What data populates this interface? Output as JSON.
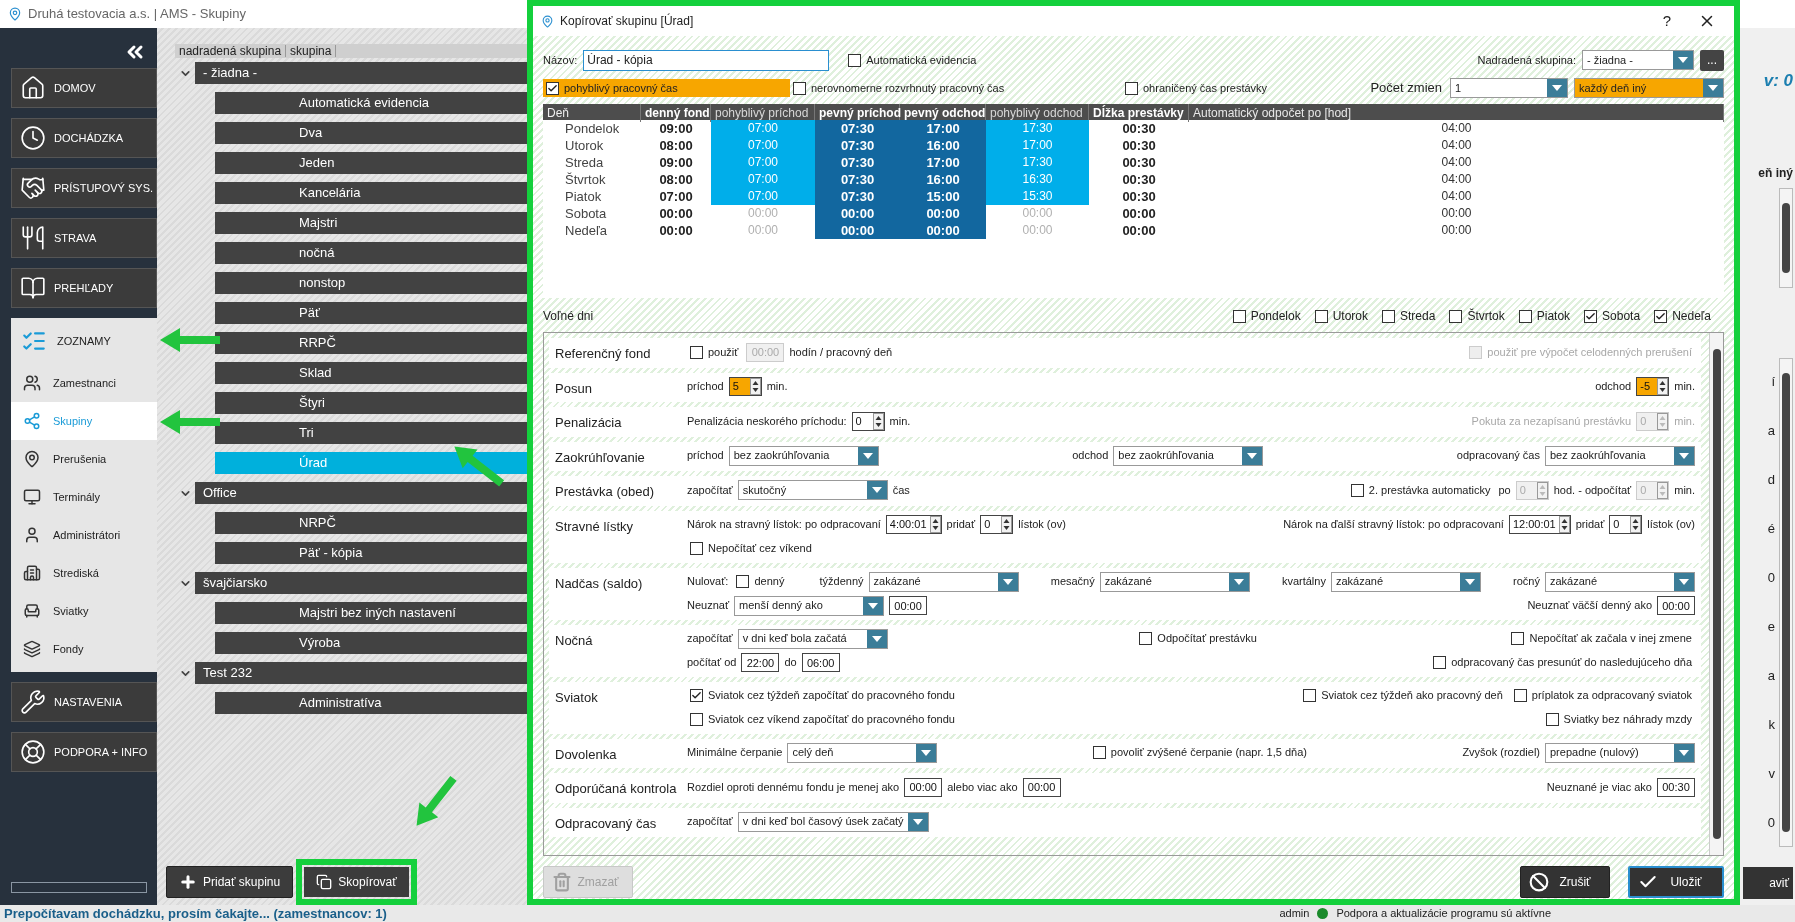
{
  "window": {
    "title": "Druhá testovacia a.s. | AMS - Skupiny"
  },
  "nav": [
    {
      "label": "DOMOV",
      "expanded": false
    },
    {
      "label": "DOCHÁDZKA",
      "expanded": false
    },
    {
      "label": "PRÍSTUPOVÝ SYS.",
      "expanded": false
    },
    {
      "label": "STRAVA",
      "expanded": false
    },
    {
      "label": "PREHĽADY",
      "expanded": false
    },
    {
      "label": "ZOZNAMY",
      "expanded": true,
      "children": [
        {
          "label": "Zamestnanci",
          "selected": false
        },
        {
          "label": "Skupiny",
          "selected": true
        },
        {
          "label": "Prerušenia",
          "selected": false
        },
        {
          "label": "Terminály",
          "selected": false
        },
        {
          "label": "Administrátori",
          "selected": false
        },
        {
          "label": "Strediská",
          "selected": false
        },
        {
          "label": "Sviatky",
          "selected": false
        },
        {
          "label": "Fondy",
          "selected": false
        }
      ]
    },
    {
      "label": "NASTAVENIA",
      "expanded": false
    },
    {
      "label": "PODPORA + INFO",
      "expanded": false
    }
  ],
  "tree": {
    "columns": [
      "nadradená skupina",
      "skupina"
    ],
    "groups": [
      {
        "label": "- žiadna -",
        "expanded": true,
        "children": [
          {
            "label": "Automatická evidencia",
            "selected": false
          },
          {
            "label": "Dva",
            "selected": false
          },
          {
            "label": "Jeden",
            "selected": false
          },
          {
            "label": "Kancelária",
            "selected": false
          },
          {
            "label": "Majstri",
            "selected": false
          },
          {
            "label": "nočná",
            "selected": false
          },
          {
            "label": "nonstop",
            "selected": false
          },
          {
            "label": "Päť",
            "selected": false
          },
          {
            "label": "RRPČ",
            "selected": false
          },
          {
            "label": "Sklad",
            "selected": false
          },
          {
            "label": "Štyri",
            "selected": false
          },
          {
            "label": "Tri",
            "selected": false
          },
          {
            "label": "Úrad",
            "selected": true
          }
        ]
      },
      {
        "label": "Office",
        "expanded": true,
        "children": [
          {
            "label": "NRPČ",
            "selected": false
          },
          {
            "label": "Päť - kópia",
            "selected": false
          }
        ]
      },
      {
        "label": "švajčiarsko",
        "expanded": true,
        "children": [
          {
            "label": "Majstri bez iných nastavení",
            "selected": false
          },
          {
            "label": "Výroba",
            "selected": false
          }
        ]
      },
      {
        "label": "Test 232",
        "expanded": true,
        "children": [
          {
            "label": "Administratíva",
            "selected": false
          }
        ]
      }
    ]
  },
  "tree_buttons": [
    "Pridať skupinu",
    "Skopírovať"
  ],
  "background_panel": {
    "count": "v: 0",
    "mode": "eň iný",
    "fragments": [
      "í",
      "a",
      "d",
      "é",
      "0",
      "e",
      "a",
      "k",
      "v",
      "0"
    ],
    "button": "aviť"
  },
  "status_bar": {
    "message": "Prepočítavam dochádzku, prosím čakajte... (zamestnancov: 1)",
    "user": "admin",
    "support": "Podpora a aktualizácie programu sú aktívne"
  },
  "dialog": {
    "title": "Kopírovať skupinu [Úrad]",
    "help": "?",
    "name": {
      "label": "Názov:",
      "value": "Úrad - kópia"
    },
    "auto_evidence": {
      "label": "Automatická evidencia",
      "checked": false
    },
    "parent": {
      "label": "Nadradená skupina:",
      "value": "- žiadna -",
      "more": "..."
    },
    "options": [
      {
        "label": "pohyblivý pracovný čas",
        "checked": true
      },
      {
        "label": "nerovnomerne rozvrhnutý pracovný čas",
        "checked": false
      },
      {
        "label": "ohraničený čas prestávky",
        "checked": false
      }
    ],
    "shifts": {
      "label": "Počet zmien",
      "count": {
        "value": "1",
        "highlighted": false
      },
      "mode": {
        "value": "každý deň iný",
        "highlighted": true
      }
    },
    "schedule": {
      "columns": [
        "Deň",
        "denný fond",
        "pohyblivý príchod",
        "pevný príchod",
        "pevný odchod",
        "pohyblivý odchod",
        "Dĺžka prestávky",
        "Automatický odpočet po [hod]"
      ],
      "rows": [
        {
          "cells": [
            "Pondelok",
            "09:00",
            "07:00",
            "07:30",
            "17:00",
            "17:30",
            "00:30",
            "04:00"
          ],
          "flexible": true
        },
        {
          "cells": [
            "Utorok",
            "08:00",
            "07:00",
            "07:30",
            "16:00",
            "17:00",
            "00:30",
            "04:00"
          ],
          "flexible": true
        },
        {
          "cells": [
            "Streda",
            "09:00",
            "07:00",
            "07:30",
            "17:00",
            "17:30",
            "00:30",
            "04:00"
          ],
          "flexible": true
        },
        {
          "cells": [
            "Štvrtok",
            "08:00",
            "07:00",
            "07:30",
            "16:00",
            "16:30",
            "00:30",
            "04:00"
          ],
          "flexible": true
        },
        {
          "cells": [
            "Piatok",
            "07:00",
            "07:00",
            "07:30",
            "15:00",
            "15:30",
            "00:30",
            "04:00"
          ],
          "flexible": true
        },
        {
          "cells": [
            "Sobota",
            "00:00",
            "00:00",
            "00:00",
            "00:00",
            "00:00",
            "00:00",
            "00:00"
          ],
          "flexible": false
        },
        {
          "cells": [
            "Nedeľa",
            "00:00",
            "00:00",
            "00:00",
            "00:00",
            "00:00",
            "00:00",
            "00:00"
          ],
          "flexible": false
        }
      ]
    },
    "free_days": {
      "label": "Voľné dni",
      "days": [
        {
          "label": "Pondelok",
          "checked": false
        },
        {
          "label": "Utorok",
          "checked": false
        },
        {
          "label": "Streda",
          "checked": false
        },
        {
          "label": "Štvrtok",
          "checked": false
        },
        {
          "label": "Piatok",
          "checked": false
        },
        {
          "label": "Sobota",
          "checked": true
        },
        {
          "label": "Nedeľa",
          "checked": true
        }
      ]
    },
    "settings": [
      {
        "title": "Referenčný fond",
        "lines": [
          {
            "groups": [
              [
                {
                  "kind": "checkbox",
                  "label": "použiť",
                  "checked": false,
                  "disabled": false
                },
                {
                  "kind": "input",
                  "value": "00:00",
                  "disabled": true
                },
                {
                  "kind": "text",
                  "text": "hodín / pracovný deň",
                  "disabled": false
                }
              ],
              [
                {
                  "kind": "checkbox",
                  "label": "použiť pre výpočet celodenných prerušení",
                  "checked": false,
                  "disabled": true
                }
              ]
            ]
          }
        ]
      },
      {
        "title": "Posun",
        "lines": [
          {
            "groups": [
              [
                {
                  "kind": "text",
                  "text": "príchod",
                  "disabled": false
                },
                {
                  "kind": "spin",
                  "value": "5",
                  "highlighted": true,
                  "disabled": false
                },
                {
                  "kind": "text",
                  "text": "min.",
                  "disabled": false
                }
              ],
              [
                {
                  "kind": "text",
                  "text": "odchod",
                  "disabled": false
                },
                {
                  "kind": "spin",
                  "value": "-5",
                  "highlighted": true,
                  "disabled": false
                },
                {
                  "kind": "text",
                  "text": "min.",
                  "disabled": false
                }
              ]
            ]
          }
        ]
      },
      {
        "title": "Penalizácia",
        "lines": [
          {
            "groups": [
              [
                {
                  "kind": "text",
                  "text": "Penalizácia neskorého príchodu:",
                  "disabled": false
                },
                {
                  "kind": "spin",
                  "value": "0",
                  "highlighted": false,
                  "disabled": false
                },
                {
                  "kind": "text",
                  "text": "min.",
                  "disabled": false
                }
              ],
              [
                {
                  "kind": "text",
                  "text": "Pokuta za nezapísanú prestávku",
                  "disabled": true
                },
                {
                  "kind": "spin",
                  "value": "0",
                  "highlighted": false,
                  "disabled": true
                },
                {
                  "kind": "text",
                  "text": "min.",
                  "disabled": true
                }
              ]
            ]
          }
        ]
      },
      {
        "title": "Zaokrúhľovanie",
        "lines": [
          {
            "groups": [
              [
                {
                  "kind": "text",
                  "text": "príchod",
                  "disabled": false
                },
                {
                  "kind": "select",
                  "value": "bez zaokrúhľovania",
                  "disabled": false
                }
              ],
              [
                {
                  "kind": "text",
                  "text": "odchod",
                  "disabled": false
                },
                {
                  "kind": "select",
                  "value": "bez zaokrúhľovania",
                  "disabled": false
                }
              ],
              [
                {
                  "kind": "text",
                  "text": "odpracovaný čas",
                  "disabled": false
                },
                {
                  "kind": "select",
                  "value": "bez zaokrúhľovania",
                  "disabled": false
                }
              ]
            ]
          }
        ]
      },
      {
        "title": "Prestávka (obed)",
        "lines": [
          {
            "groups": [
              [
                {
                  "kind": "text",
                  "text": "započítať",
                  "disabled": false
                },
                {
                  "kind": "select",
                  "value": "skutočný",
                  "disabled": false
                },
                {
                  "kind": "text",
                  "text": "čas",
                  "disabled": false
                }
              ],
              [
                {
                  "kind": "checkbox",
                  "label": "2. prestávka automaticky",
                  "checked": false,
                  "disabled": false
                },
                {
                  "kind": "text",
                  "text": "po",
                  "disabled": false
                },
                {
                  "kind": "spin",
                  "value": "0",
                  "highlighted": false,
                  "disabled": true
                },
                {
                  "kind": "text",
                  "text": "hod. - odpočítať",
                  "disabled": false
                },
                {
                  "kind": "spin",
                  "value": "0",
                  "highlighted": false,
                  "disabled": true
                },
                {
                  "kind": "text",
                  "text": "min.",
                  "disabled": false
                }
              ]
            ]
          }
        ]
      },
      {
        "title": "Stravné lístky",
        "lines": [
          {
            "groups": [
              [
                {
                  "kind": "text",
                  "text": "Nárok na stravný lístok: po odpracovaní",
                  "disabled": false
                },
                {
                  "kind": "spin",
                  "value": "4:00:01",
                  "highlighted": false,
                  "disabled": false
                },
                {
                  "kind": "text",
                  "text": "pridať",
                  "disabled": false
                },
                {
                  "kind": "spin",
                  "value": "0",
                  "highlighted": false,
                  "disabled": false
                },
                {
                  "kind": "text",
                  "text": "lístok (ov)",
                  "disabled": false
                }
              ],
              [
                {
                  "kind": "text",
                  "text": "Nárok na ďalší stravný lístok: po odpracovaní",
                  "disabled": false
                },
                {
                  "kind": "spin",
                  "value": "12:00:01",
                  "highlighted": false,
                  "disabled": false
                },
                {
                  "kind": "text",
                  "text": "pridať",
                  "disabled": false
                },
                {
                  "kind": "spin",
                  "value": "0",
                  "highlighted": false,
                  "disabled": false
                },
                {
                  "kind": "text",
                  "text": "lístok (ov)",
                  "disabled": false
                }
              ]
            ]
          },
          {
            "groups": [
              [
                {
                  "kind": "checkbox",
                  "label": "Nepočítať cez víkend",
                  "checked": false,
                  "disabled": false
                }
              ]
            ]
          }
        ]
      },
      {
        "title": "Nadčas (saldo)",
        "lines": [
          {
            "groups": [
              [
                {
                  "kind": "text",
                  "text": "Nulovať:",
                  "disabled": false
                },
                {
                  "kind": "checkbox",
                  "label": "denný",
                  "checked": false,
                  "disabled": false
                }
              ],
              [
                {
                  "kind": "text",
                  "text": "týždenný",
                  "disabled": false
                },
                {
                  "kind": "select",
                  "value": "zakázané",
                  "disabled": false
                }
              ],
              [
                {
                  "kind": "text",
                  "text": "mesačný",
                  "disabled": false
                },
                {
                  "kind": "select",
                  "value": "zakázané",
                  "disabled": false
                }
              ],
              [
                {
                  "kind": "text",
                  "text": "kvartálny",
                  "disabled": false
                },
                {
                  "kind": "select",
                  "value": "zakázané",
                  "disabled": false
                }
              ],
              [
                {
                  "kind": "text",
                  "text": "ročný",
                  "disabled": false
                },
                {
                  "kind": "select",
                  "value": "zakázané",
                  "disabled": false
                }
              ]
            ]
          },
          {
            "groups": [
              [
                {
                  "kind": "text",
                  "text": "Neuznať",
                  "disabled": false
                },
                {
                  "kind": "select",
                  "value": "menší denný ako",
                  "disabled": false
                },
                {
                  "kind": "input",
                  "value": "00:00",
                  "disabled": false
                }
              ],
              [
                {
                  "kind": "text",
                  "text": "Neuznať väčší denný ako",
                  "disabled": false
                },
                {
                  "kind": "input",
                  "value": "00:00",
                  "disabled": false
                }
              ]
            ]
          }
        ]
      },
      {
        "title": "Nočná",
        "lines": [
          {
            "groups": [
              [
                {
                  "kind": "text",
                  "text": "započítať",
                  "disabled": false
                },
                {
                  "kind": "select",
                  "value": "v dni keď bola začatá",
                  "disabled": false
                }
              ],
              [
                {
                  "kind": "checkbox",
                  "label": "Odpočítať prestávku",
                  "checked": false,
                  "disabled": false
                }
              ],
              [
                {
                  "kind": "checkbox",
                  "label": "Nepočítať ak začala v inej zmene",
                  "checked": false,
                  "disabled": false
                }
              ]
            ]
          },
          {
            "groups": [
              [
                {
                  "kind": "text",
                  "text": "počítať od",
                  "disabled": false
                },
                {
                  "kind": "input",
                  "value": "22:00",
                  "disabled": false
                },
                {
                  "kind": "text",
                  "text": "do",
                  "disabled": false
                },
                {
                  "kind": "input",
                  "value": "06:00",
                  "disabled": false
                }
              ],
              [
                {
                  "kind": "checkbox",
                  "label": "odpracovaný čas presunúť do nasledujúceho dňa",
                  "checked": false,
                  "disabled": false
                }
              ]
            ]
          }
        ]
      },
      {
        "title": "Sviatok",
        "lines": [
          {
            "groups": [
              [
                {
                  "kind": "checkbox",
                  "label": "Sviatok cez týždeň započítať do pracovného fondu",
                  "checked": true,
                  "disabled": false
                }
              ],
              [
                {
                  "kind": "checkbox",
                  "label": "Sviatok cez týždeň ako pracovný deň",
                  "checked": false,
                  "disabled": false
                },
                {
                  "kind": "checkbox",
                  "label": "príplatok za odpracovaný sviatok",
                  "checked": false,
                  "disabled": false
                }
              ]
            ]
          },
          {
            "groups": [
              [
                {
                  "kind": "checkbox",
                  "label": "Sviatok cez víkend započítať do pracovného fondu",
                  "checked": false,
                  "disabled": false
                }
              ],
              [
                {
                  "kind": "checkbox",
                  "label": "Sviatky bez náhrady mzdy",
                  "checked": false,
                  "disabled": false
                }
              ]
            ]
          }
        ]
      },
      {
        "title": "Dovolenka",
        "lines": [
          {
            "groups": [
              [
                {
                  "kind": "text",
                  "text": "Minimálne čerpanie",
                  "disabled": false
                },
                {
                  "kind": "select",
                  "value": "celý deň",
                  "disabled": false
                }
              ],
              [
                {
                  "kind": "checkbox",
                  "label": "povoliť zvýšené čerpanie (napr. 1,5 dňa)",
                  "checked": false,
                  "disabled": false
                }
              ],
              [
                {
                  "kind": "text",
                  "text": "Zvyšok (rozdiel)",
                  "disabled": false
                },
                {
                  "kind": "select",
                  "value": "prepadne (nulový)",
                  "disabled": false
                }
              ]
            ]
          }
        ]
      },
      {
        "title": "Odporúčaná kontrola",
        "lines": [
          {
            "groups": [
              [
                {
                  "kind": "text",
                  "text": "Rozdiel oproti dennému fondu je menej ako",
                  "disabled": false
                },
                {
                  "kind": "input",
                  "value": "00:00",
                  "disabled": false
                },
                {
                  "kind": "text",
                  "text": "alebo viac ako",
                  "disabled": false
                },
                {
                  "kind": "input",
                  "value": "00:00",
                  "disabled": false
                }
              ],
              [
                {
                  "kind": "text",
                  "text": "Neuznané je viac ako",
                  "disabled": false
                },
                {
                  "kind": "input",
                  "value": "00:30",
                  "disabled": false
                }
              ]
            ]
          }
        ]
      },
      {
        "title": "Odpracovaný čas",
        "lines": [
          {
            "groups": [
              [
                {
                  "kind": "text",
                  "text": "započítať",
                  "disabled": false
                },
                {
                  "kind": "select",
                  "value": "v dni keď bol časový úsek začatý",
                  "disabled": false
                }
              ]
            ]
          }
        ]
      }
    ],
    "actions": [
      {
        "label": "Zmazať",
        "disabled": true
      },
      {
        "label": "Zrušiť",
        "disabled": false
      },
      {
        "label": "Uložiť",
        "disabled": false
      }
    ]
  }
}
